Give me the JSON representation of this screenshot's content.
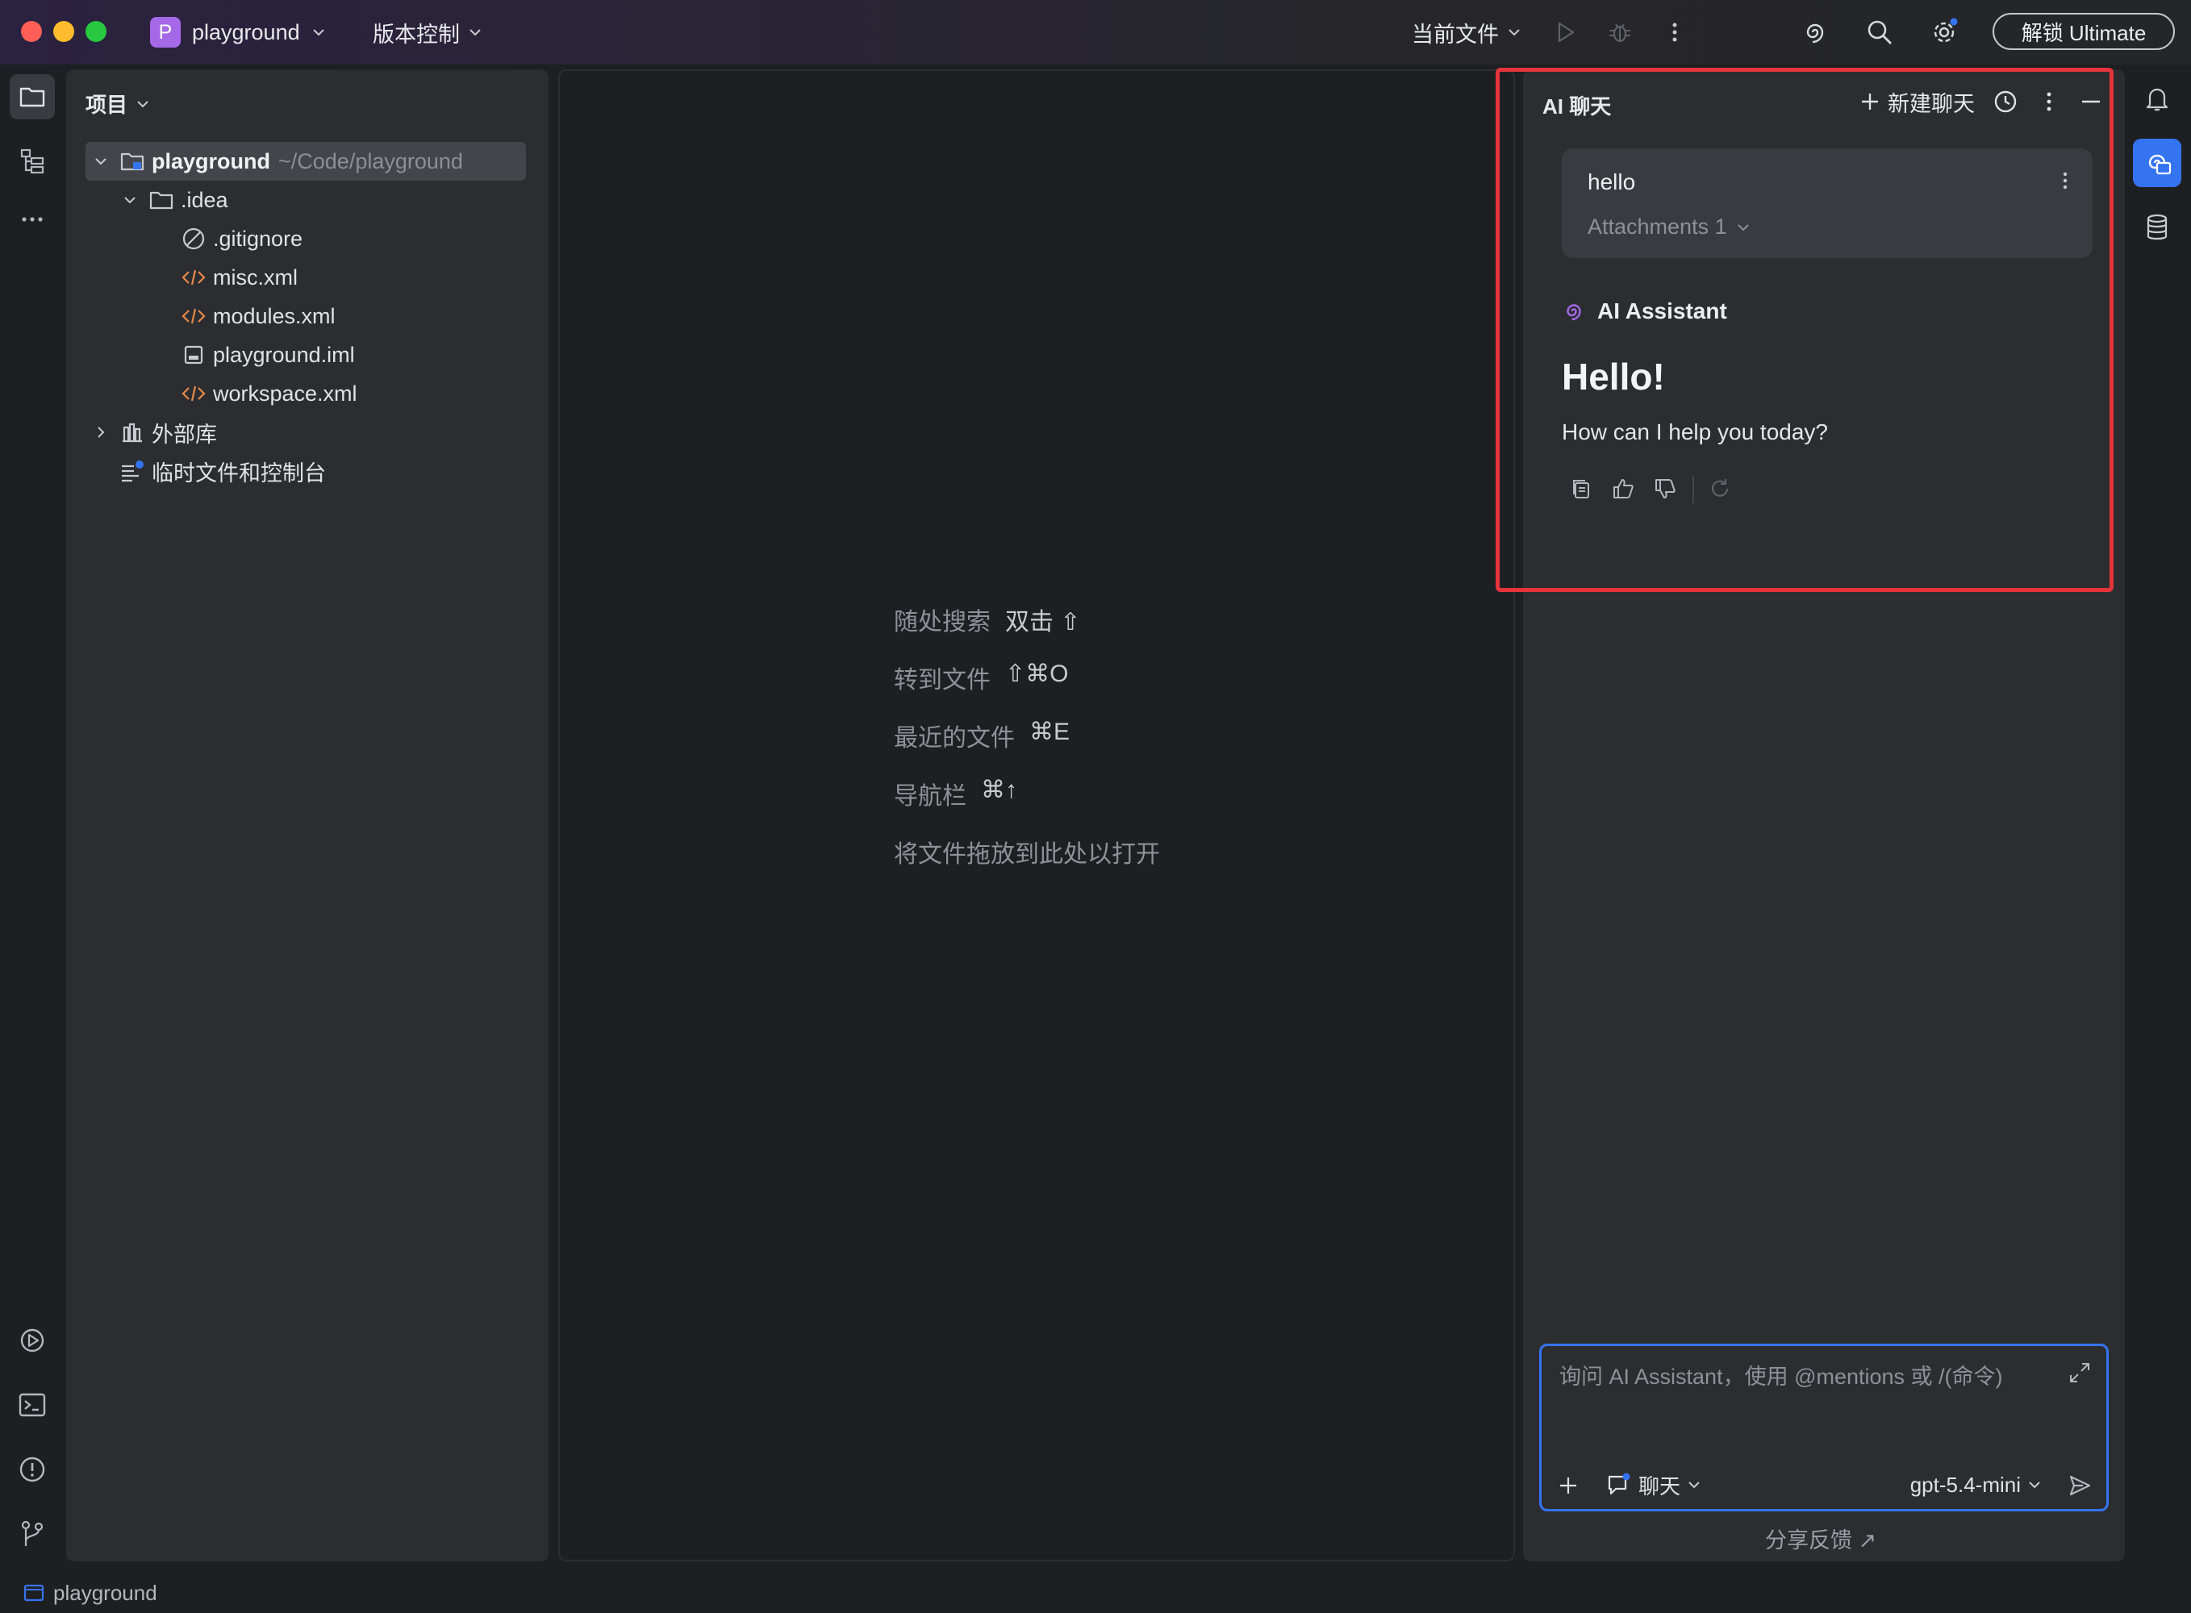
{
  "titlebar": {
    "project_initial": "P",
    "project_name": "playground",
    "vcs_label": "版本控制",
    "run_config": "当前文件",
    "unlock_label": "解锁 Ultimate"
  },
  "project_panel": {
    "title": "项目",
    "tree": [
      {
        "label": "playground",
        "path": "~/Code/playground"
      },
      {
        "label": ".idea"
      },
      {
        "label": ".gitignore"
      },
      {
        "label": "misc.xml"
      },
      {
        "label": "modules.xml"
      },
      {
        "label": "playground.iml"
      },
      {
        "label": "workspace.xml"
      },
      {
        "label": "外部库"
      },
      {
        "label": "临时文件和控制台"
      }
    ]
  },
  "editor": {
    "hints": [
      {
        "action": "随处搜索",
        "key": "双击 ⇧"
      },
      {
        "action": "转到文件",
        "key": "⇧⌘O"
      },
      {
        "action": "最近的文件",
        "key": "⌘E"
      },
      {
        "action": "导航栏",
        "key": "⌘↑"
      },
      {
        "action": "将文件拖放到此处以打开",
        "key": ""
      }
    ]
  },
  "ai_chat": {
    "title": "AI 聊天",
    "new_chat": "新建聊天",
    "user_message": "hello",
    "attachments_label": "Attachments 1",
    "assistant_name": "AI Assistant",
    "greeting": "Hello!",
    "help_text": "How can I help you today?",
    "input_placeholder": "询问 AI Assistant，使用 @mentions 或 /(命令)",
    "mode_label": "聊天",
    "model_label": "gpt-5.4-mini",
    "share_feedback": "分享反馈 ↗"
  },
  "statusbar": {
    "project": "playground"
  },
  "colors": {
    "accent": "#3574f0",
    "highlight": "#e5343b",
    "project_badge": "#a569e8",
    "xml_icon": "#e8894a"
  }
}
